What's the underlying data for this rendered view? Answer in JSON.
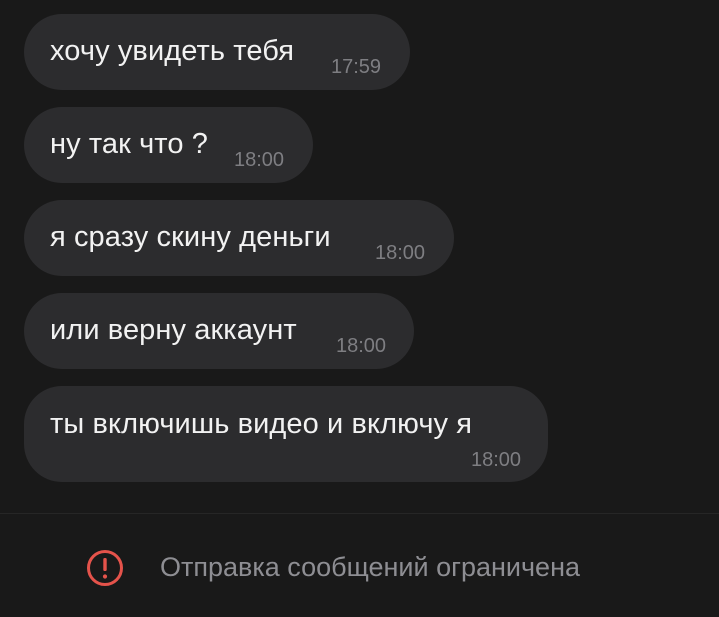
{
  "messages": [
    {
      "text": "хочу увидеть тебя",
      "time": "17:59"
    },
    {
      "text": "ну так что ?",
      "time": "18:00"
    },
    {
      "text": "я сразу скину деньги",
      "time": "18:00"
    },
    {
      "text": "или верну аккаунт",
      "time": "18:00"
    },
    {
      "text": "ты включишь видео и включу я",
      "time": "18:00"
    }
  ],
  "footer": {
    "icon": "alert-circle-icon",
    "notice": "Отправка сообщений ограничена"
  },
  "colors": {
    "background": "#191919",
    "bubble": "#2c2c2e",
    "message_text": "#f2f2f2",
    "timestamp": "#7e7e82",
    "notice_text": "#8e8e93",
    "alert": "#e5534b"
  }
}
